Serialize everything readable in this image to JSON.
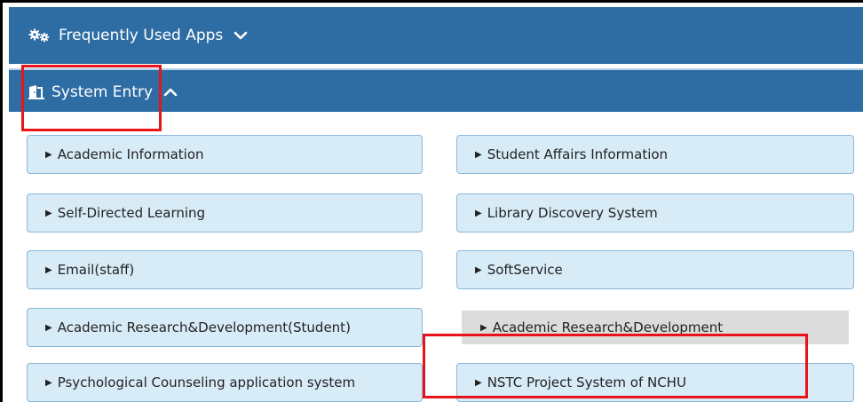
{
  "header": {
    "frequently_used_apps": "Frequently Used Apps",
    "system_entry": "System Entry"
  },
  "tiles": {
    "academic_information": "Academic Information",
    "student_affairs_information": "Student Affairs Information",
    "self_directed_learning": "Self-Directed Learning",
    "library_discovery_system": "Library Discovery System",
    "email_staff": "Email(staff)",
    "softservice": "SoftService",
    "academic_rd_student": "Academic Research&Development(Student)",
    "academic_rd": "Academic Research&Development",
    "psychological_counseling": "Psychological Counseling application system",
    "nstc_project_system": "NSTC Project System of NCHU"
  },
  "icons": {
    "frequently_used_apps": "gears-icon",
    "system_entry": "door-entry-icon",
    "tile_arrow": "triangle-right-icon"
  },
  "colors": {
    "header_bar": "#2e6da4",
    "tile_background": "#d8ecf8",
    "tile_border": "#8ab7d9",
    "tile_hover": "#dcdcdc",
    "highlight_box": "#e8141a"
  }
}
